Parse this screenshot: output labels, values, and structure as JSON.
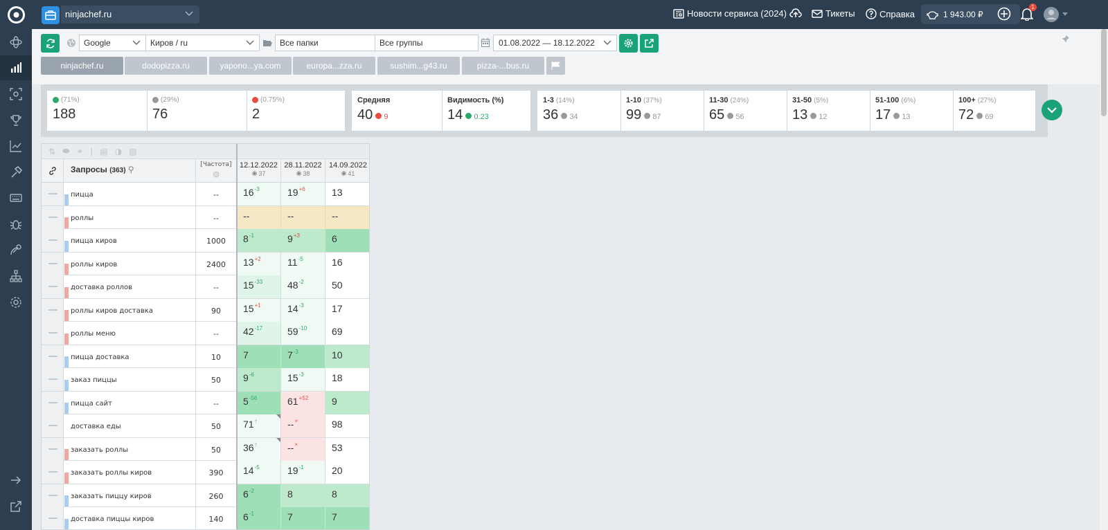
{
  "project": {
    "name": "ninjachef.ru"
  },
  "topbar": {
    "news": "Новости сервиса (2024)",
    "tickets": "Тикеты",
    "help": "Справка",
    "balance": "1 943.00 ₽",
    "notifications": "1"
  },
  "filters": {
    "engine": "Google",
    "region": "Киров / ru",
    "folders": "Все папки",
    "groups": "Все группы",
    "date_range": "01.08.2022 — 18.12.2022"
  },
  "sites": [
    "ninjachef.ru",
    "dodopizza.ru",
    "yapono...ya.com",
    "europa...zza.ru",
    "sushim...g43.ru",
    "pizza-...bus.ru"
  ],
  "stats": {
    "up": {
      "pct": "(71%)",
      "value": "188"
    },
    "same": {
      "pct": "(29%)",
      "value": "76"
    },
    "down": {
      "pct": "(0.75%)",
      "value": "2"
    },
    "average": {
      "label": "Средняя",
      "value": "40",
      "delta": "9"
    },
    "visibility": {
      "label": "Видимость (%)",
      "value": "14",
      "delta": "0.23"
    },
    "ranges": [
      {
        "label": "1-3",
        "pct": "(14%)",
        "value": "36",
        "prev": "34"
      },
      {
        "label": "1-10",
        "pct": "(37%)",
        "value": "99",
        "prev": "87"
      },
      {
        "label": "11-30",
        "pct": "(24%)",
        "value": "65",
        "prev": "56"
      },
      {
        "label": "31-50",
        "pct": "(5%)",
        "value": "13",
        "prev": "12"
      },
      {
        "label": "51-100",
        "pct": "(6%)",
        "value": "17",
        "prev": "13"
      },
      {
        "label": "100+",
        "pct": "(27%)",
        "value": "72",
        "prev": "69"
      }
    ]
  },
  "table": {
    "title": "Запросы",
    "count": "(363)",
    "freq_header": "[Частота]",
    "dates": [
      {
        "date": "12.12.2022",
        "sub": "37"
      },
      {
        "date": "28.11.2022",
        "sub": "38"
      },
      {
        "date": "14.09.2022",
        "sub": "41"
      }
    ],
    "rows": [
      {
        "q": "пицца",
        "f": "--",
        "bar": "blue",
        "c": [
          {
            "v": "16",
            "d": "-3",
            "dc": "up",
            "bg": "g1"
          },
          {
            "v": "19",
            "d": "+6",
            "dc": "down",
            "bg": "g1"
          },
          {
            "v": "13",
            "d": "",
            "dc": "",
            "bg": "w"
          }
        ]
      },
      {
        "q": "роллы",
        "f": "--",
        "bar": "red",
        "c": [
          {
            "v": "--",
            "d": "",
            "dc": "",
            "bg": "y"
          },
          {
            "v": "--",
            "d": "",
            "dc": "",
            "bg": "y"
          },
          {
            "v": "--",
            "d": "",
            "dc": "",
            "bg": "y"
          }
        ]
      },
      {
        "q": "пицца киров",
        "f": "1000",
        "bar": "blue",
        "c": [
          {
            "v": "8",
            "d": "-1",
            "dc": "up",
            "bg": "g3"
          },
          {
            "v": "9",
            "d": "+3",
            "dc": "down",
            "bg": "g3"
          },
          {
            "v": "6",
            "d": "",
            "dc": "",
            "bg": "g4"
          }
        ]
      },
      {
        "q": "роллы киров",
        "f": "2400",
        "bar": "red",
        "c": [
          {
            "v": "13",
            "d": "+2",
            "dc": "down",
            "bg": "g1"
          },
          {
            "v": "11",
            "d": "-5",
            "dc": "up",
            "bg": "g1"
          },
          {
            "v": "16",
            "d": "",
            "dc": "",
            "bg": "w"
          }
        ]
      },
      {
        "q": "доставка роллов",
        "f": "--",
        "bar": "red",
        "c": [
          {
            "v": "15",
            "d": "-33",
            "dc": "up",
            "bg": "g2"
          },
          {
            "v": "48",
            "d": "-2",
            "dc": "up",
            "bg": "g1"
          },
          {
            "v": "50",
            "d": "",
            "dc": "",
            "bg": "w"
          }
        ]
      },
      {
        "q": "роллы киров доставка",
        "f": "90",
        "bar": "red",
        "c": [
          {
            "v": "15",
            "d": "+1",
            "dc": "down",
            "bg": "g1"
          },
          {
            "v": "14",
            "d": "-3",
            "dc": "up",
            "bg": "g1"
          },
          {
            "v": "17",
            "d": "",
            "dc": "",
            "bg": "w"
          }
        ]
      },
      {
        "q": "роллы меню",
        "f": "--",
        "bar": "red",
        "c": [
          {
            "v": "42",
            "d": "-17",
            "dc": "up",
            "bg": "g2"
          },
          {
            "v": "59",
            "d": "-10",
            "dc": "up",
            "bg": "g1"
          },
          {
            "v": "69",
            "d": "",
            "dc": "",
            "bg": "w"
          }
        ]
      },
      {
        "q": "пицца доставка",
        "f": "10",
        "bar": "blue",
        "c": [
          {
            "v": "7",
            "d": "",
            "dc": "",
            "bg": "g4"
          },
          {
            "v": "7",
            "d": "-3",
            "dc": "up",
            "bg": "g4"
          },
          {
            "v": "10",
            "d": "",
            "dc": "",
            "bg": "g3"
          }
        ]
      },
      {
        "q": "заказ пиццы",
        "f": "50",
        "bar": "blue",
        "c": [
          {
            "v": "9",
            "d": "-6",
            "dc": "up",
            "bg": "g3"
          },
          {
            "v": "15",
            "d": "-3",
            "dc": "up",
            "bg": "g1"
          },
          {
            "v": "18",
            "d": "",
            "dc": "",
            "bg": "w"
          }
        ]
      },
      {
        "q": "пицца сайт",
        "f": "--",
        "bar": "blue",
        "c": [
          {
            "v": "5",
            "d": "-56",
            "dc": "up",
            "bg": "g4"
          },
          {
            "v": "61",
            "d": "+52",
            "dc": "down",
            "bg": "r"
          },
          {
            "v": "9",
            "d": "",
            "dc": "",
            "bg": "g3"
          }
        ]
      },
      {
        "q": "доставка еды",
        "f": "50",
        "bar": "none",
        "c": [
          {
            "v": "71",
            "d": "↑",
            "dc": "up",
            "bg": "g1",
            "corner": true
          },
          {
            "v": "--",
            "d": "×",
            "dc": "down",
            "bg": "r"
          },
          {
            "v": "98",
            "d": "",
            "dc": "",
            "bg": "w"
          }
        ]
      },
      {
        "q": "заказать роллы",
        "f": "50",
        "bar": "red",
        "c": [
          {
            "v": "36",
            "d": "↑",
            "dc": "up",
            "bg": "g1",
            "corner": true
          },
          {
            "v": "--",
            "d": "×",
            "dc": "down",
            "bg": "r"
          },
          {
            "v": "53",
            "d": "",
            "dc": "",
            "bg": "w"
          }
        ]
      },
      {
        "q": "заказать роллы киров",
        "f": "390",
        "bar": "red",
        "c": [
          {
            "v": "14",
            "d": "-5",
            "dc": "up",
            "bg": "g1"
          },
          {
            "v": "19",
            "d": "-1",
            "dc": "up",
            "bg": "g1"
          },
          {
            "v": "20",
            "d": "",
            "dc": "",
            "bg": "w"
          }
        ]
      },
      {
        "q": "заказать пиццу киров",
        "f": "260",
        "bar": "blue",
        "c": [
          {
            "v": "6",
            "d": "-2",
            "dc": "up",
            "bg": "g4"
          },
          {
            "v": "8",
            "d": "",
            "dc": "",
            "bg": "g3"
          },
          {
            "v": "8",
            "d": "",
            "dc": "",
            "bg": "g3"
          }
        ]
      },
      {
        "q": "доставка пиццы киров",
        "f": "140",
        "bar": "blue",
        "c": [
          {
            "v": "6",
            "d": "-1",
            "dc": "up",
            "bg": "g4"
          },
          {
            "v": "7",
            "d": "",
            "dc": "",
            "bg": "g4"
          },
          {
            "v": "7",
            "d": "",
            "dc": "",
            "bg": "g4"
          }
        ]
      }
    ]
  }
}
